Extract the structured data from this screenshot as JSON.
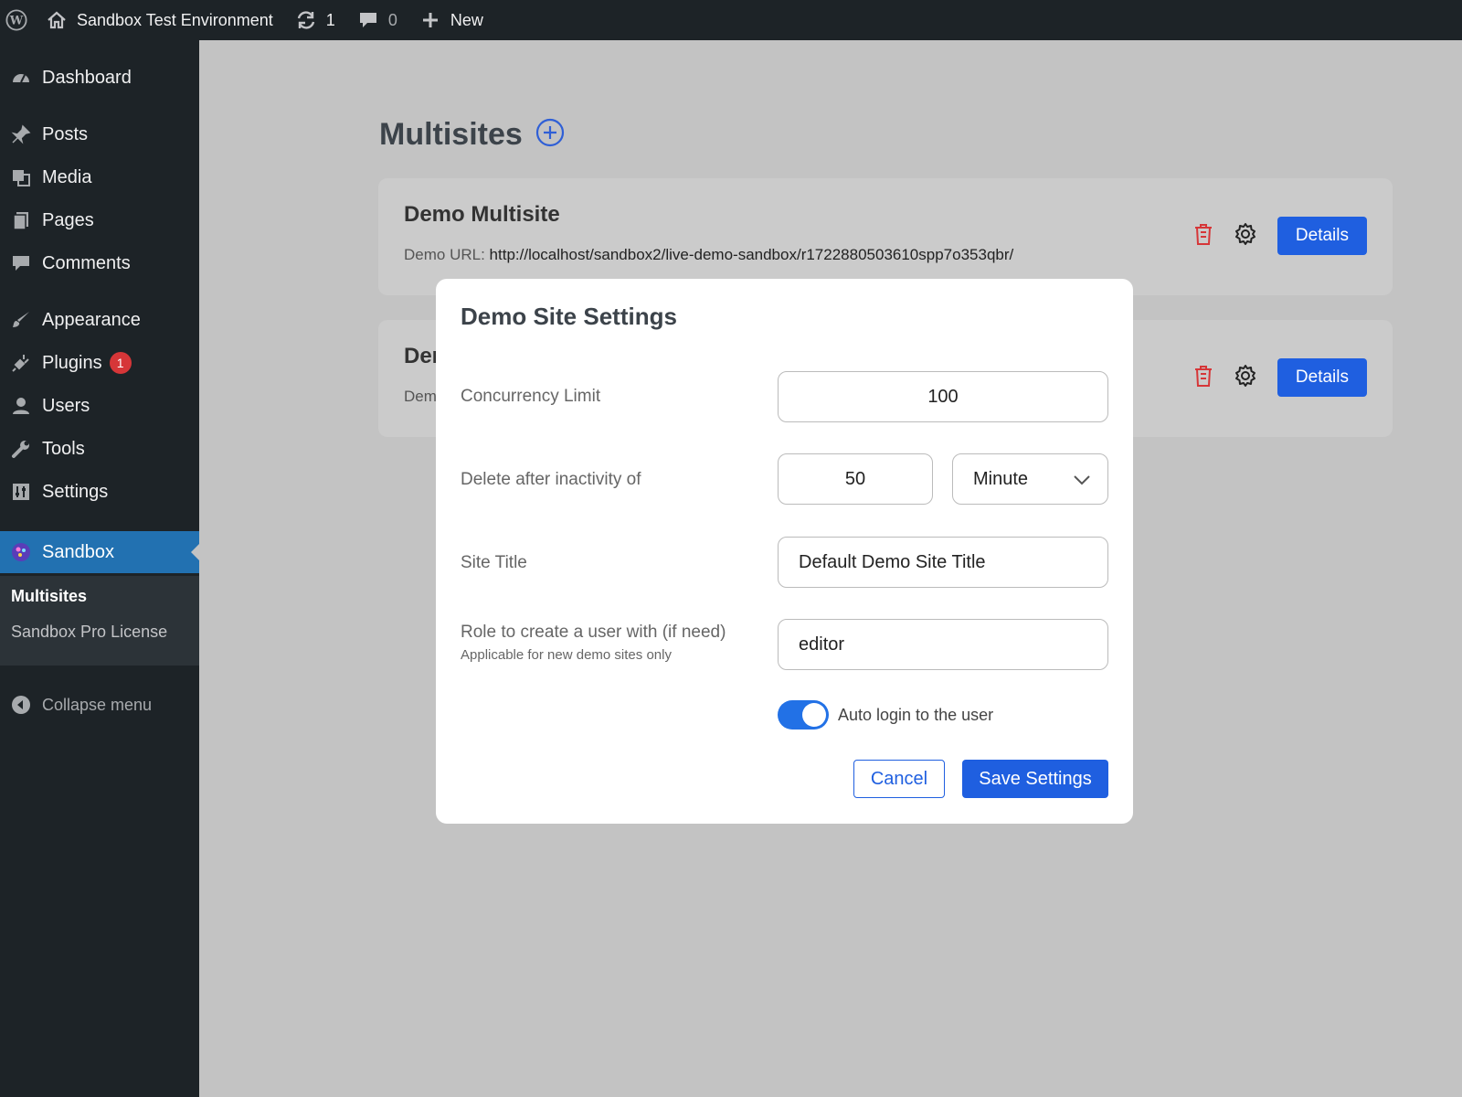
{
  "admin_bar": {
    "site_name": "Sandbox Test Environment",
    "updates_count": "1",
    "comments_count": "0",
    "new_label": "New"
  },
  "sidebar": {
    "items": [
      {
        "label": "Dashboard",
        "icon": "dashboard-icon"
      },
      {
        "label": "Posts",
        "icon": "pin-icon"
      },
      {
        "label": "Media",
        "icon": "media-icon"
      },
      {
        "label": "Pages",
        "icon": "pages-icon"
      },
      {
        "label": "Comments",
        "icon": "comment-icon"
      },
      {
        "label": "Appearance",
        "icon": "brush-icon"
      },
      {
        "label": "Plugins",
        "icon": "plug-icon",
        "badge": "1"
      },
      {
        "label": "Users",
        "icon": "user-icon"
      },
      {
        "label": "Tools",
        "icon": "wrench-icon"
      },
      {
        "label": "Settings",
        "icon": "settings-icon"
      },
      {
        "label": "Sandbox",
        "icon": "sandbox-icon",
        "current": true
      }
    ],
    "submenu": [
      "Multisites",
      "Sandbox Pro License"
    ],
    "collapse_label": "Collapse menu"
  },
  "main": {
    "page_title": "Multisites",
    "cards": [
      {
        "title": "Demo Multisite",
        "url_label": "Demo URL:",
        "url": "http://localhost/sandbox2/live-demo-sandbox/r1722880503610spp7o353qbr/",
        "details_label": "Details"
      },
      {
        "title": "Demo Multisite",
        "url_label": "Demo URL:",
        "url": "",
        "details_label": "Details"
      }
    ]
  },
  "modal": {
    "title": "Demo Site Settings",
    "concurrency_label": "Concurrency Limit",
    "concurrency_value": "100",
    "inactivity_label": "Delete after inactivity of",
    "inactivity_value": "50",
    "inactivity_unit": "Minute",
    "site_title_label": "Site Title",
    "site_title_value": "Default Demo Site Title",
    "role_label": "Role to create a user with (if need)",
    "role_help": "Applicable for new demo sites only",
    "role_value": "editor",
    "auto_login_label": "Auto login to the user",
    "auto_login_enabled": true,
    "cancel_label": "Cancel",
    "save_label": "Save Settings"
  },
  "colors": {
    "primary": "#1f5fe0",
    "wp_blue": "#2271b1",
    "danger": "#d63638"
  }
}
